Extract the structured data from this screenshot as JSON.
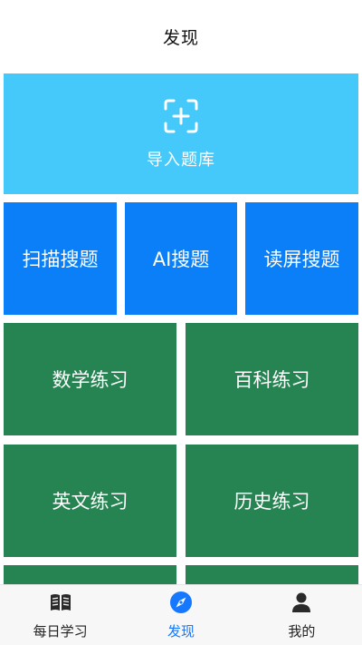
{
  "header": {
    "title": "发现"
  },
  "import_tile": {
    "label": "导入题库",
    "icon": "scan-add-icon",
    "color": "#45c8fa"
  },
  "search_tiles": [
    {
      "label": "扫描搜题"
    },
    {
      "label": "AI搜题"
    },
    {
      "label": "读屏搜题"
    }
  ],
  "practice_tiles": [
    {
      "label": "数学练习"
    },
    {
      "label": "百科练习"
    },
    {
      "label": "英文练习"
    },
    {
      "label": "历史练习"
    }
  ],
  "colors": {
    "blue": "#0a7ff7",
    "green": "#268452",
    "active_tab": "#1677ff"
  },
  "tabbar": {
    "items": [
      {
        "label": "每日学习",
        "icon": "book-icon",
        "active": false
      },
      {
        "label": "发现",
        "icon": "compass-icon",
        "active": true
      },
      {
        "label": "我的",
        "icon": "person-icon",
        "active": false
      }
    ]
  }
}
